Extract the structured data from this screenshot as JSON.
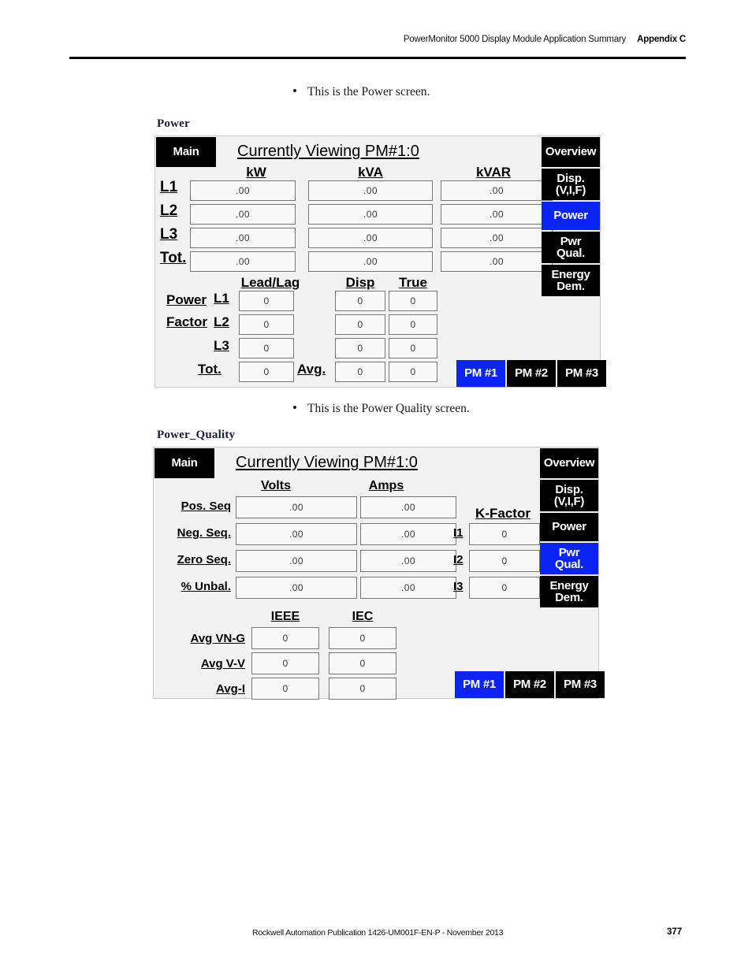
{
  "page": {
    "header_title": "PowerMonitor 5000 Display Module Application Summary",
    "header_appendix": "Appendix C",
    "footer_publication": "Rockwell Automation Publication 1426-UM001F-EN-P - November 2013",
    "footer_page_number": "377"
  },
  "bullets": {
    "power": "This is the Power screen.",
    "power_quality": "This is the Power Quality screen."
  },
  "colors": {
    "active_button": "#0b24f5",
    "button": "#000000",
    "panel_background": "#f2f2f2",
    "field_background": "#f8f8f8"
  },
  "power_screen": {
    "caption": "Power",
    "main_button": "Main",
    "title": "Currently Viewing PM#1:0",
    "column_headers": [
      "kW",
      "kVA",
      "kVAR"
    ],
    "row_labels": [
      "L1",
      "L2",
      "L3",
      "Tot."
    ],
    "values": [
      [
        ".00",
        ".00",
        ".00"
      ],
      [
        ".00",
        ".00",
        ".00"
      ],
      [
        ".00",
        ".00",
        ".00"
      ],
      [
        ".00",
        ".00",
        ".00"
      ]
    ],
    "pf_group_label_line1": "Power",
    "pf_group_label_line2": "Factor",
    "pf_headers": [
      "Lead/Lag",
      "Disp",
      "True"
    ],
    "pf_row_labels": [
      "L1",
      "L2",
      "L3",
      "Tot."
    ],
    "pf_avg_label": "Avg.",
    "pf_values": [
      [
        "0",
        "0",
        "0"
      ],
      [
        "0",
        "0",
        "0"
      ],
      [
        "0",
        "0",
        "0"
      ],
      [
        "0",
        "0",
        "0"
      ]
    ],
    "nav_buttons": [
      {
        "label": "Overview",
        "lines": [
          "Overview"
        ],
        "active": false
      },
      {
        "label": "Disp. (V,I,F)",
        "lines": [
          "Disp.",
          "(V,I,F)"
        ],
        "active": false
      },
      {
        "label": "Power",
        "lines": [
          "Power"
        ],
        "active": true
      },
      {
        "label": "Pwr Qual.",
        "lines": [
          "Pwr",
          "Qual."
        ],
        "active": false
      },
      {
        "label": "Energy Dem.",
        "lines": [
          "Energy",
          "Dem."
        ],
        "active": false
      }
    ],
    "pm_buttons": [
      {
        "label": "PM #1",
        "active": true
      },
      {
        "label": "PM #2",
        "active": false
      },
      {
        "label": "PM #3",
        "active": false
      }
    ]
  },
  "power_quality_screen": {
    "caption": "Power_Quality",
    "main_button": "Main",
    "title": "Currently Viewing PM#1:0",
    "column_headers": [
      "Volts",
      "Amps"
    ],
    "row_labels": [
      "Pos. Seq",
      "Neg. Seq.",
      "Zero Seq.",
      "% Unbal."
    ],
    "values": [
      [
        ".00",
        ".00"
      ],
      [
        ".00",
        ".00"
      ],
      [
        ".00",
        ".00"
      ],
      [
        ".00",
        ".00"
      ]
    ],
    "kfactor_header": "K-Factor",
    "kfactor_row_labels": [
      "I1",
      "I2",
      "I3"
    ],
    "kfactor_values": [
      "0",
      "0",
      "0"
    ],
    "std_headers": [
      "IEEE",
      "IEC"
    ],
    "std_row_labels": [
      "Avg VN-G",
      "Avg V-V",
      "Avg-I"
    ],
    "std_values": [
      [
        "0",
        "0"
      ],
      [
        "0",
        "0"
      ],
      [
        "0",
        "0"
      ]
    ],
    "nav_buttons": [
      {
        "label": "Overview",
        "lines": [
          "Overview"
        ],
        "active": false
      },
      {
        "label": "Disp. (V,I,F)",
        "lines": [
          "Disp.",
          "(V,I,F)"
        ],
        "active": false
      },
      {
        "label": "Power",
        "lines": [
          "Power"
        ],
        "active": false
      },
      {
        "label": "Pwr Qual.",
        "lines": [
          "Pwr",
          "Qual."
        ],
        "active": true
      },
      {
        "label": "Energy Dem.",
        "lines": [
          "Energy",
          "Dem."
        ],
        "active": false
      }
    ],
    "pm_buttons": [
      {
        "label": "PM #1",
        "active": true
      },
      {
        "label": "PM #2",
        "active": false
      },
      {
        "label": "PM #3",
        "active": false
      }
    ]
  }
}
